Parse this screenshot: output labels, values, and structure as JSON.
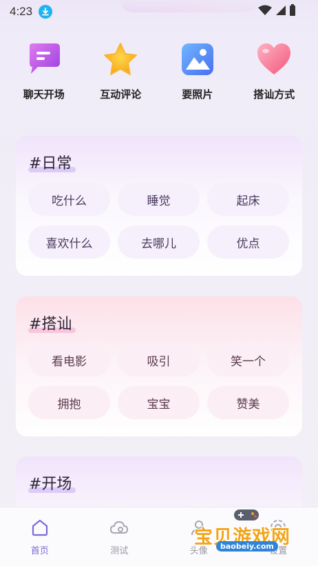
{
  "status_bar": {
    "time": "4:23"
  },
  "features": [
    {
      "label": "聊天开场",
      "icon": "chat-bubble-icon"
    },
    {
      "label": "互动评论",
      "icon": "star-icon"
    },
    {
      "label": "要照片",
      "icon": "photo-icon"
    },
    {
      "label": "搭讪方式",
      "icon": "heart-icon"
    }
  ],
  "cards": [
    {
      "title": "#日常",
      "tags": [
        "吃什么",
        "睡觉",
        "起床",
        "喜欢什么",
        "去哪儿",
        "优点"
      ]
    },
    {
      "title": "#搭讪",
      "tags": [
        "看电影",
        "吸引",
        "笑一个",
        "拥抱",
        "宝宝",
        "赞美"
      ]
    },
    {
      "title": "#开场",
      "tags": []
    }
  ],
  "bottom_nav": [
    {
      "label": "首页",
      "icon": "home-icon",
      "active": true
    },
    {
      "label": "测试",
      "icon": "cloud-icon",
      "active": false
    },
    {
      "label": "头像",
      "icon": "avatar-icon",
      "active": false
    },
    {
      "label": "设置",
      "icon": "settings-icon",
      "active": false
    }
  ],
  "watermark": {
    "text": "宝贝游戏网",
    "url": "baobeiy.com"
  },
  "colors": {
    "accent": "#7a6bd6",
    "download_badge": "#1fb3f1",
    "watermark": "#f2a51a"
  }
}
